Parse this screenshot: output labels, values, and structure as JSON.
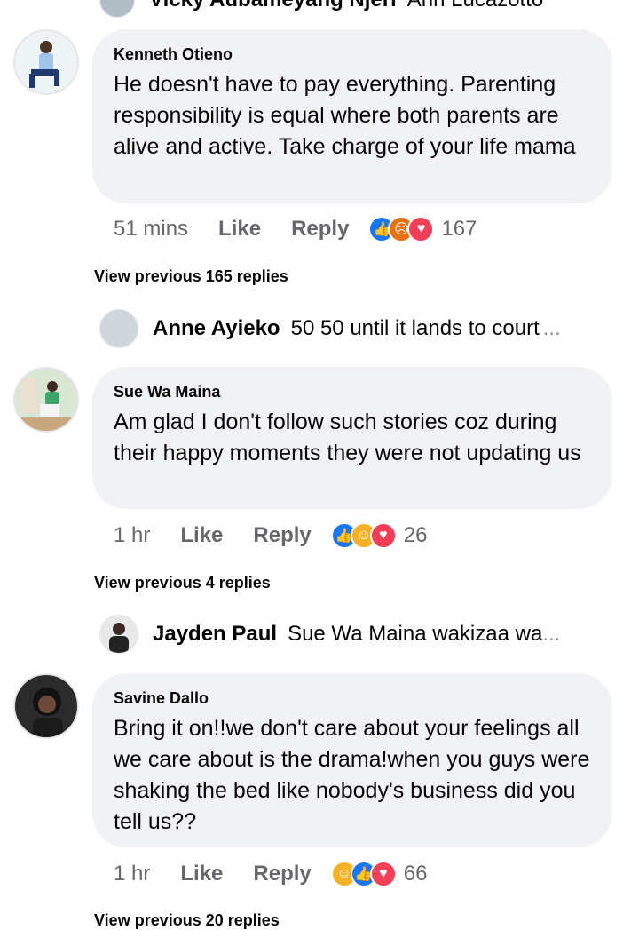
{
  "top_reply": {
    "name": "Vicky Aubameyang Njeri",
    "snippet": "Ann Lucazotto"
  },
  "comments": [
    {
      "author": "Kenneth Otieno",
      "text": "He doesn't have to pay everything. Parenting responsibility is equal where both parents are alive and active. Take charge of your life mama",
      "time": "51 mins",
      "like_label": "Like",
      "reply_label": "Reply",
      "reaction_count": "167",
      "view_previous": "View previous 165 replies",
      "reply": {
        "name": "Anne Ayieko",
        "snippet": "50 50 until it lands to court",
        "ellipsis": "..."
      }
    },
    {
      "author": "Sue Wa Maina",
      "text": "Am glad I don't follow such stories coz during their happy moments they were not updating us",
      "time": "1 hr",
      "like_label": "Like",
      "reply_label": "Reply",
      "reaction_count": "26",
      "view_previous": "View previous 4 replies",
      "reply": {
        "name": "Jayden Paul",
        "snippet": "Sue Wa Maina  wakizaa wa",
        "ellipsis": "..."
      }
    },
    {
      "author": "Savine Dallo",
      "text": "Bring it on!!we don't care about your feelings all we care about is the drama!when you guys were shaking the bed like nobody's business did you tell us??",
      "time": "1 hr",
      "like_label": "Like",
      "reply_label": "Reply",
      "reaction_count": "66",
      "view_previous": "View previous 20 replies"
    }
  ],
  "reaction_icons": {
    "c1": [
      "like-icon",
      "angry-icon",
      "love-icon"
    ],
    "c2": [
      "like-icon",
      "haha-icon",
      "love-icon"
    ],
    "c3": [
      "haha-icon",
      "like-icon",
      "love-icon"
    ]
  }
}
